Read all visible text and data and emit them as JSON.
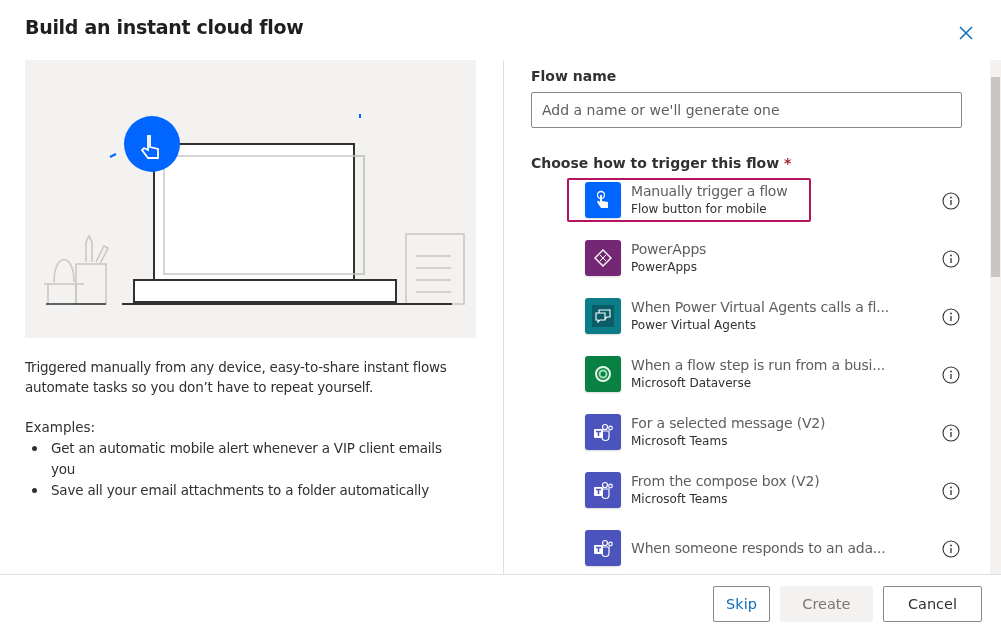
{
  "dialog": {
    "title": "Build an instant cloud flow"
  },
  "description": "Triggered manually from any device, easy-to-share instant flows automate tasks so you don’t have to repeat yourself.",
  "examples": {
    "heading": "Examples:",
    "items": [
      "Get an automatic mobile alert whenever a VIP client emails you",
      "Save all your email attachments to a folder automatically"
    ]
  },
  "flow_name": {
    "label": "Flow name",
    "placeholder": "Add a name or we'll generate one"
  },
  "trigger": {
    "label": "Choose how to trigger this flow",
    "required_mark": "*",
    "options": [
      {
        "kind": "manual",
        "title": "Manually trigger a flow",
        "subtitle": "Flow button for mobile",
        "selected": true
      },
      {
        "kind": "powerapps",
        "title": "PowerApps",
        "subtitle": "PowerApps",
        "selected": false
      },
      {
        "kind": "pva",
        "title": "When Power Virtual Agents calls a fl...",
        "subtitle": "Power Virtual Agents",
        "selected": false
      },
      {
        "kind": "dataverse",
        "title": "When a flow step is run from a busi...",
        "subtitle": "Microsoft Dataverse",
        "selected": false
      },
      {
        "kind": "teams",
        "title": "For a selected message (V2)",
        "subtitle": "Microsoft Teams",
        "selected": false
      },
      {
        "kind": "teams",
        "title": "From the compose box (V2)",
        "subtitle": "Microsoft Teams",
        "selected": false
      },
      {
        "kind": "teams",
        "title": "When someone responds to an ada...",
        "selected": false
      }
    ]
  },
  "buttons": [
    {
      "label": "Skip",
      "kind": "secondary",
      "disabled": false
    },
    {
      "label": "Create",
      "kind": "primary",
      "disabled": true
    },
    {
      "label": "Cancel",
      "kind": "plain",
      "disabled": false
    }
  ]
}
